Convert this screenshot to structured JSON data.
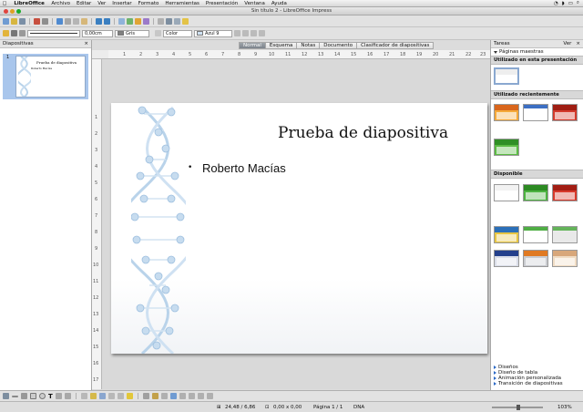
{
  "menubar": {
    "app": "LibreOffice",
    "items": [
      "Archivo",
      "Editar",
      "Ver",
      "Insertar",
      "Formato",
      "Herramientas",
      "Presentación",
      "Ventana",
      "Ayuda"
    ]
  },
  "window": {
    "title": "Sin título 2 - LibreOffice Impress"
  },
  "line_toolbar": {
    "line_width": "0,00cm",
    "line_color": "Gris",
    "area_type": "Color",
    "area_color": "Azul 9"
  },
  "slides_panel": {
    "title": "Diapositivas",
    "close": "×",
    "thumbnail": {
      "number": "1",
      "title": "Prueba de diapositiva",
      "subtitle": "Roberto Macías"
    }
  },
  "view_tabs": [
    "Normal",
    "Esquema",
    "Notas",
    "Documento",
    "Clasificador de diapositivas"
  ],
  "active_view_tab": 0,
  "rulers": {
    "horizontal": [
      "1",
      "2",
      "3",
      "4",
      "5",
      "6",
      "7",
      "8",
      "9",
      "10",
      "11",
      "12",
      "13",
      "14",
      "15",
      "16",
      "17",
      "18",
      "19",
      "20",
      "21",
      "22",
      "23"
    ],
    "vertical": [
      "1",
      "2",
      "3",
      "4",
      "5",
      "6",
      "7",
      "8",
      "9",
      "10",
      "11",
      "12",
      "13",
      "14",
      "15",
      "16",
      "17"
    ]
  },
  "slide": {
    "title": "Prueba de diapositiva",
    "bullet": "•",
    "body": "Roberto Macías"
  },
  "tasks_panel": {
    "title": "Tareas",
    "view_label": "Ver",
    "close": "×",
    "master_pages": "Páginas maestras",
    "sections": [
      {
        "title": "Utilizado en esta presentación",
        "themes": [
          "white"
        ]
      },
      {
        "title": "Utilizado recientemente",
        "themes": [
          "orange",
          "blue",
          "red",
          "green"
        ]
      },
      {
        "title": "Disponible",
        "themes": [
          "white",
          "green",
          "red",
          "blue-green",
          "green-white",
          "grey-green",
          "navy",
          "orange-grey",
          "beige"
        ]
      }
    ],
    "collapsed": [
      "Diseños",
      "Diseño de tabla",
      "Animación personalizada",
      "Transición de diapositivas"
    ]
  },
  "statusbar": {
    "position": "24,48 / 6,86",
    "size": "0,00 x 0,00",
    "page": "Página 1 / 1",
    "master": "DNA",
    "zoom": "103%"
  },
  "colors": {
    "active_tab": "#8a9098",
    "selection": "#a9c6ec",
    "helix": "#b9d3ea"
  }
}
